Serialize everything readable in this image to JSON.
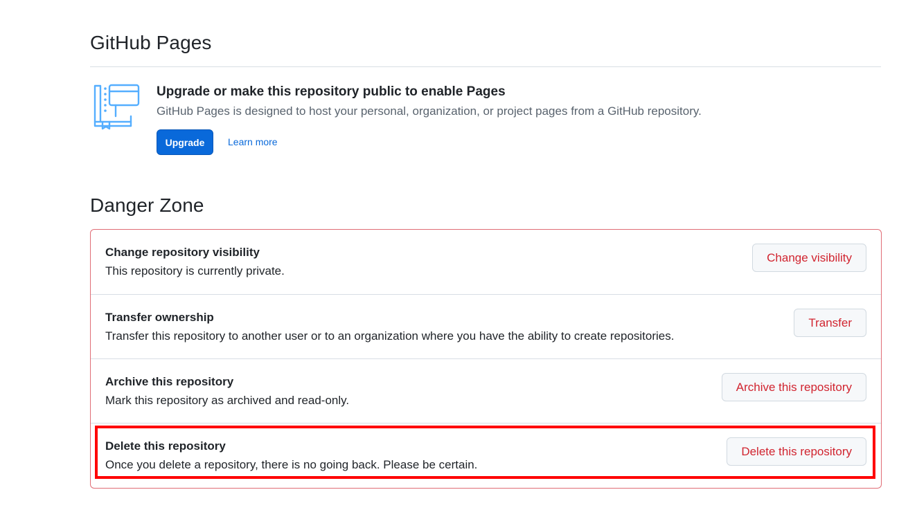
{
  "pages": {
    "title": "GitHub Pages",
    "heading": "Upgrade or make this repository public to enable Pages",
    "description": "GitHub Pages is designed to host your personal, organization, or project pages from a GitHub repository.",
    "upgrade_label": "Upgrade",
    "learn_more_label": "Learn more",
    "icon": "pages-book-icon"
  },
  "danger": {
    "title": "Danger Zone",
    "rows": [
      {
        "title": "Change repository visibility",
        "description": "This repository is currently private.",
        "button": "Change visibility"
      },
      {
        "title": "Transfer ownership",
        "description": "Transfer this repository to another user or to an organization where you have the ability to create repositories.",
        "button": "Transfer"
      },
      {
        "title": "Archive this repository",
        "description": "Mark this repository as archived and read-only.",
        "button": "Archive this repository"
      },
      {
        "title": "Delete this repository",
        "description": "Once you delete a repository, there is no going back. Please be certain.",
        "button": "Delete this repository"
      }
    ]
  },
  "colors": {
    "accent": "#0969da",
    "danger": "#d1242f",
    "highlight": "#ff0000"
  }
}
